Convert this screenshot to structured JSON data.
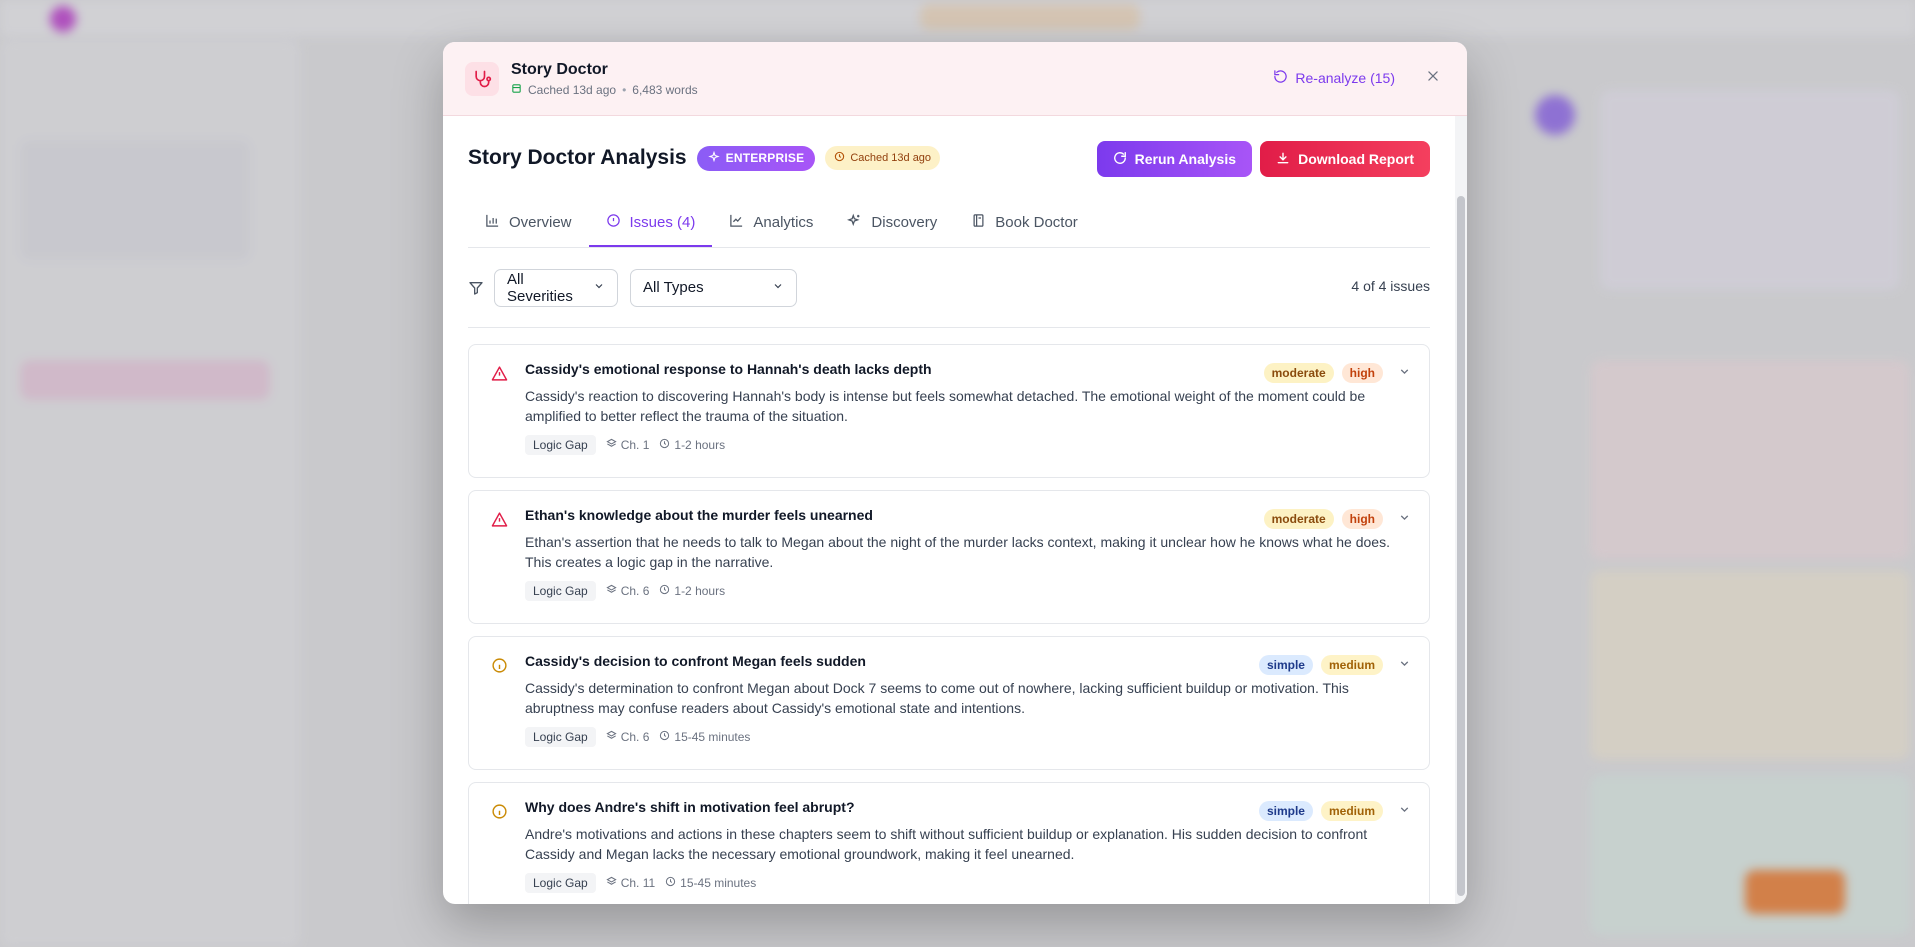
{
  "header": {
    "title": "Story Doctor",
    "cache_status": "Cached 13d ago",
    "word_count": "6,483 words",
    "reanalyze_label": "Re-analyze (15)"
  },
  "analysis": {
    "title": "Story Doctor Analysis",
    "tier_badge": "ENTERPRISE",
    "cache_badge": "Cached 13d ago",
    "rerun_label": "Rerun Analysis",
    "download_label": "Download Report"
  },
  "tabs": [
    {
      "label": "Overview",
      "icon": "bar-chart-icon"
    },
    {
      "label": "Issues (4)",
      "icon": "alert-circle-icon"
    },
    {
      "label": "Analytics",
      "icon": "line-chart-icon"
    },
    {
      "label": "Discovery",
      "icon": "sparkles-icon"
    },
    {
      "label": "Book Doctor",
      "icon": "book-icon"
    }
  ],
  "active_tab": "Issues (4)",
  "filters": {
    "severity_value": "All Severities",
    "type_value": "All Types",
    "count_label": "4 of 4 issues"
  },
  "issues": [
    {
      "title": "Cassidy's emotional response to Hannah's death lacks depth",
      "description": "Cassidy's reaction to discovering Hannah's body is intense but feels somewhat detached. The emotional weight of the moment could be amplified to better reflect the trauma of the situation.",
      "type": "Logic Gap",
      "chapter": "Ch. 1",
      "time": "1-2 hours",
      "complexity": "moderate",
      "priority": "high",
      "icon": "warning-triangle-icon"
    },
    {
      "title": "Ethan's knowledge about the murder feels unearned",
      "description": "Ethan's assertion that he needs to talk to Megan about the night of the murder lacks context, making it unclear how he knows what he does. This creates a logic gap in the narrative.",
      "type": "Logic Gap",
      "chapter": "Ch. 6",
      "time": "1-2 hours",
      "complexity": "moderate",
      "priority": "high",
      "icon": "warning-triangle-icon"
    },
    {
      "title": "Cassidy's decision to confront Megan feels sudden",
      "description": "Cassidy's determination to confront Megan about Dock 7 seems to come out of nowhere, lacking sufficient buildup or motivation. This abruptness may confuse readers about Cassidy's emotional state and intentions.",
      "type": "Logic Gap",
      "chapter": "Ch. 6",
      "time": "15-45 minutes",
      "complexity": "simple",
      "priority": "medium",
      "icon": "info-circle-icon"
    },
    {
      "title": "Why does Andre's shift in motivation feel abrupt?",
      "description": "Andre's motivations and actions in these chapters seem to shift without sufficient buildup or explanation. His sudden decision to confront Cassidy and Megan lacks the necessary emotional groundwork, making it feel unearned.",
      "type": "Logic Gap",
      "chapter": "Ch. 11",
      "time": "15-45 minutes",
      "complexity": "simple",
      "priority": "medium",
      "icon": "info-circle-icon"
    }
  ],
  "colors": {
    "accent": "#7c3aed",
    "danger": "#e11d48",
    "warning_icon": "#e11d48",
    "info_icon": "#ca8a04"
  }
}
